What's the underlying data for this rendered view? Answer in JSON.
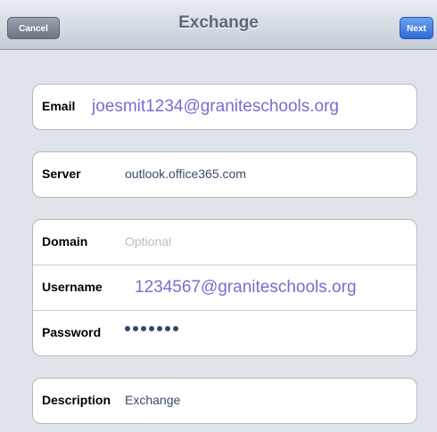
{
  "navbar": {
    "title": "Exchange",
    "cancel_label": "Cancel",
    "next_label": "Next"
  },
  "form": {
    "email": {
      "label": "Email",
      "value": "joesmit1234@graniteschools.org"
    },
    "server": {
      "label": "Server",
      "value": "outlook.office365.com"
    },
    "domain": {
      "label": "Domain",
      "placeholder": "Optional"
    },
    "username": {
      "label": "Username",
      "value": "1234567@graniteschools.org"
    },
    "password": {
      "label": "Password",
      "masked_length": 7
    },
    "description": {
      "label": "Description",
      "value": "Exchange"
    }
  },
  "colors": {
    "overlay_text": "#7d6ad0",
    "next_button": "#2c6bd8"
  }
}
